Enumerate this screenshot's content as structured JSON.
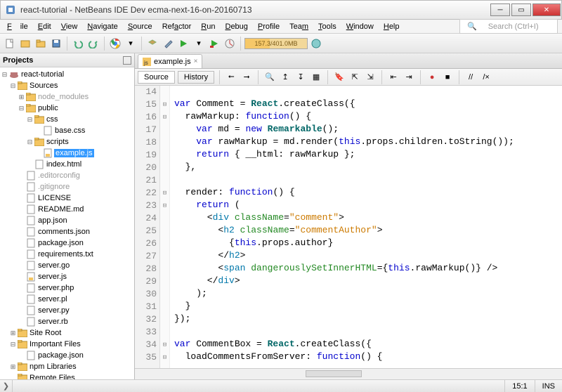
{
  "window": {
    "title": "react-tutorial - NetBeans IDE Dev ecma-next-16-on-20160713"
  },
  "menu": [
    "File",
    "Edit",
    "View",
    "Navigate",
    "Source",
    "Refactor",
    "Run",
    "Debug",
    "Profile",
    "Team",
    "Tools",
    "Window",
    "Help"
  ],
  "search_placeholder": "Search (Ctrl+I)",
  "memory_label": "157.3/401.0MB",
  "projects_title": "Projects",
  "tree": {
    "root": "react-tutorial",
    "sources": "Sources",
    "node_modules": "node_modules",
    "public": "public",
    "css": "css",
    "base_css": "base.css",
    "scripts": "scripts",
    "example_js": "example.js",
    "index_html": "index.html",
    "editorconfig": ".editorconfig",
    "gitignore": ".gitignore",
    "license": "LICENSE",
    "readme": "README.md",
    "app_json": "app.json",
    "comments_json": "comments.json",
    "package_json": "package.json",
    "requirements": "requirements.txt",
    "server_go": "server.go",
    "server_js": "server.js",
    "server_php": "server.php",
    "server_pl": "server.pl",
    "server_py": "server.py",
    "server_rb": "server.rb",
    "site_root": "Site Root",
    "important_files": "Important Files",
    "package_json2": "package.json",
    "npm_libs": "npm Libraries",
    "remote_files": "Remote Files"
  },
  "tab_label": "example.js",
  "subtabs": {
    "source": "Source",
    "history": "History"
  },
  "code": {
    "first_line_no": 14,
    "lines": [
      "",
      "var Comment = React.createClass({",
      "  rawMarkup: function() {",
      "    var md = new Remarkable();",
      "    var rawMarkup = md.render(this.props.children.toString());",
      "    return { __html: rawMarkup };",
      "  },",
      "",
      "  render: function() {",
      "    return (",
      "      <div className=\"comment\">",
      "        <h2 className=\"commentAuthor\">",
      "          {this.props.author}",
      "        </h2>",
      "        <span dangerouslySetInnerHTML={this.rawMarkup()} />",
      "      </div>",
      "    );",
      "  }",
      "});",
      "",
      "var CommentBox = React.createClass({",
      "  loadCommentsFromServer: function() {"
    ]
  },
  "status": {
    "pos": "15:1",
    "mode": "INS"
  }
}
